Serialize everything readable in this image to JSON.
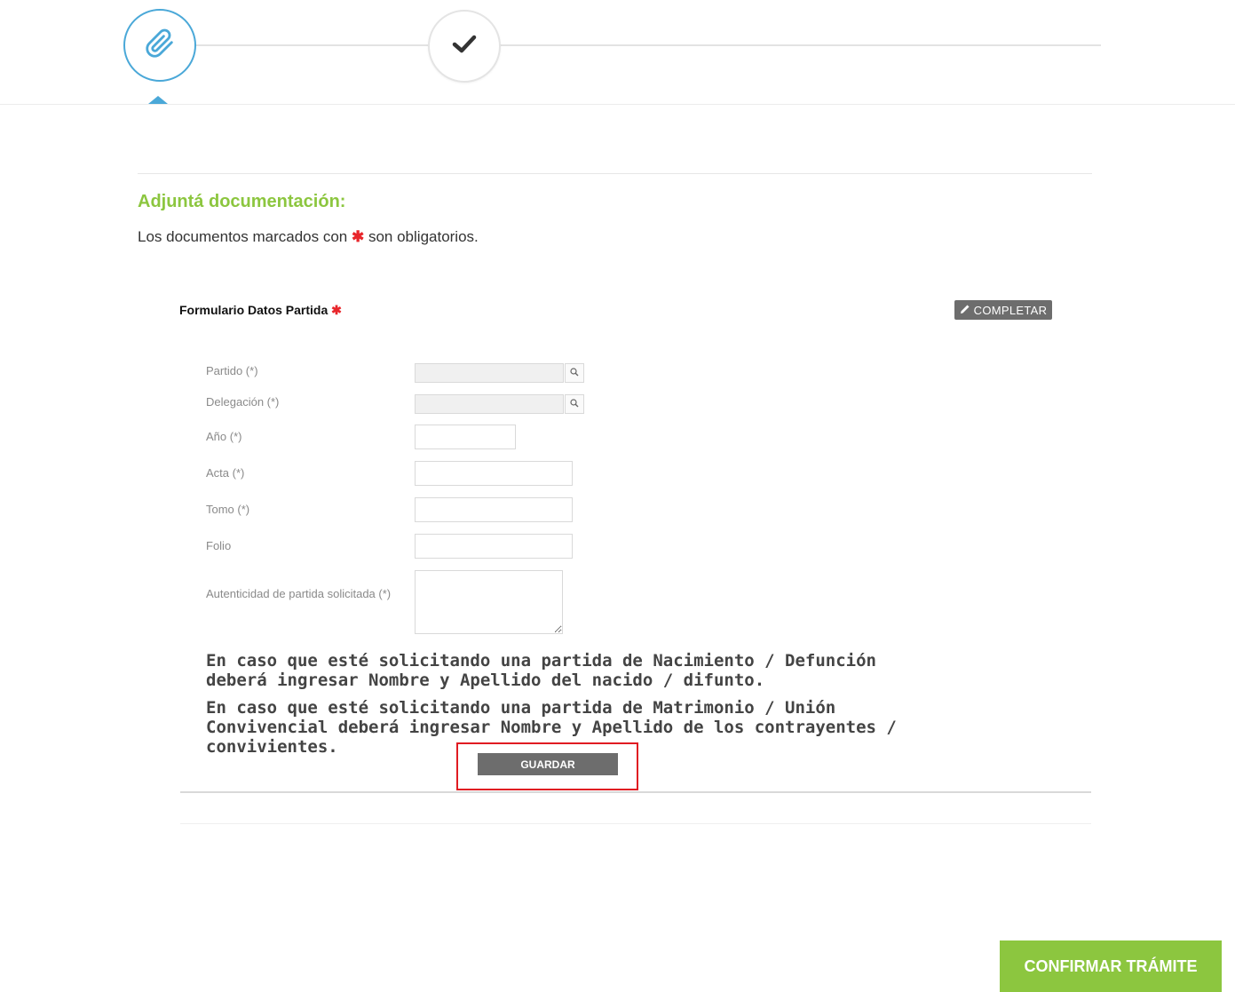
{
  "stepper": {
    "steps": [
      {
        "icon": "paperclip-icon",
        "state": "active"
      },
      {
        "icon": "checkmark-icon",
        "state": "pending"
      }
    ]
  },
  "section": {
    "title": "Adjuntá documentación:",
    "subtitle_before": "Los documentos marcados con",
    "subtitle_star": "✱",
    "subtitle_after": "son obligatorios."
  },
  "document": {
    "name": "Formulario Datos Partida",
    "required_star": "✱",
    "complete_label": "COMPLETAR"
  },
  "form": {
    "fields": [
      {
        "label": "Partido (*)",
        "value": ""
      },
      {
        "label": "Delegación (*)",
        "value": ""
      },
      {
        "label": "Año (*)",
        "value": ""
      },
      {
        "label": "Acta (*)",
        "value": ""
      },
      {
        "label": "Tomo (*)",
        "value": ""
      },
      {
        "label": "Folio",
        "value": ""
      },
      {
        "label": "Autenticidad de partida solicitada (*)",
        "value": ""
      }
    ],
    "notice_1": "En caso que esté solicitando una partida de Nacimiento / Defunción deberá ingresar Nombre y Apellido del nacido / difunto.",
    "notice_2": "En caso que esté solicitando una partida de Matrimonio / Unión Convivencial deberá ingresar Nombre y Apellido de los contrayentes / convivientes.",
    "save_label": "GUARDAR"
  },
  "footer": {
    "confirm_label": "CONFIRMAR TRÁMITE"
  },
  "colors": {
    "accent_green": "#8cc63f",
    "step_blue": "#4aa8d8",
    "required_red": "#e8262b",
    "button_gray": "#6d6d6d"
  }
}
